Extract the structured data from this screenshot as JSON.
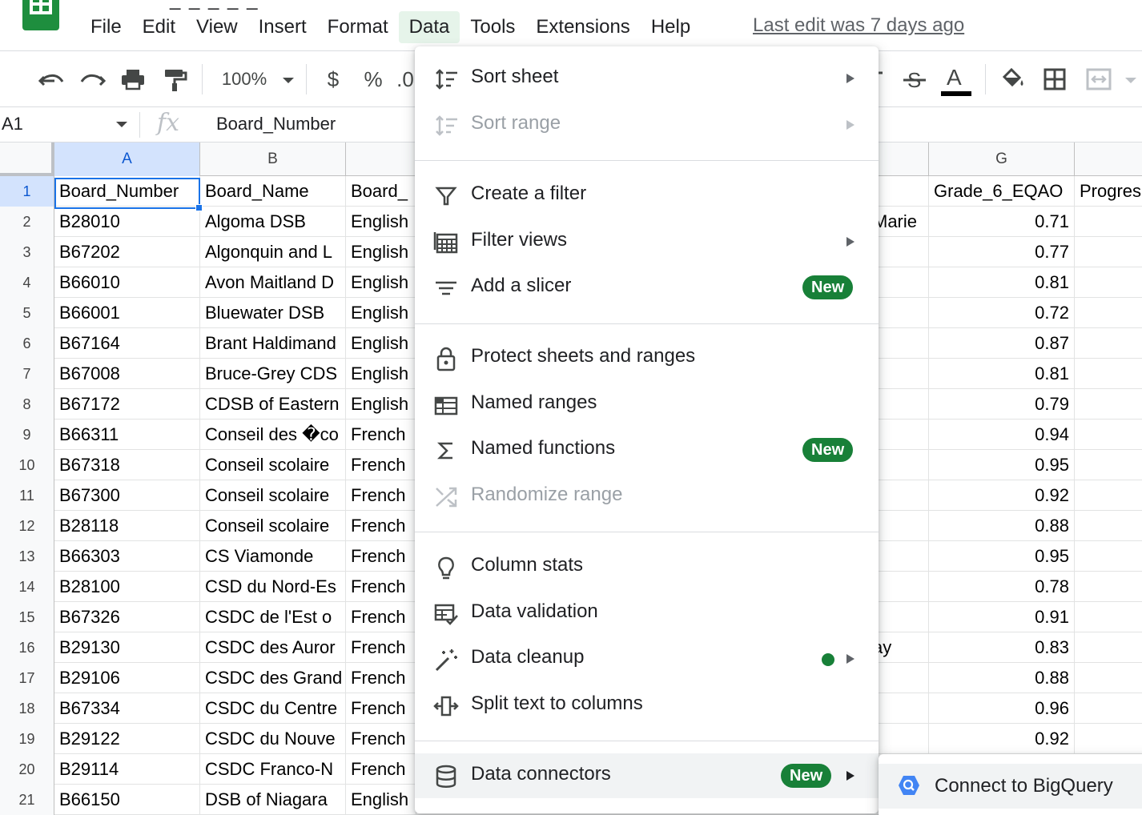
{
  "menubar": {
    "title_fragment": "_ _ _ _ _",
    "items": [
      "File",
      "Edit",
      "View",
      "Insert",
      "Format",
      "Data",
      "Tools",
      "Extensions",
      "Help"
    ],
    "last_edit": "Last edit was 7 days ago"
  },
  "toolbar": {
    "zoom": "100%",
    "currency": "$",
    "percent": "%",
    "decimal_fragment": ".0"
  },
  "formula_bar": {
    "cell_ref": "A1",
    "fx": "fx",
    "content": "Board_Number"
  },
  "columns": {
    "A": "A",
    "B": "B",
    "G": "G"
  },
  "rows": [
    {
      "num": "1",
      "a": "Board_Number",
      "b": "Board_Name",
      "c": "Board_",
      "f": "",
      "g": "Grade_6_EQAO",
      "h": "Progres"
    },
    {
      "num": "2",
      "a": "B28010",
      "b": "Algoma DSB",
      "c": "English",
      "f": "Marie",
      "g": "0.71",
      "h": ""
    },
    {
      "num": "3",
      "a": "B67202",
      "b": "Algonquin and L",
      "c": "English",
      "f": "",
      "g": "0.77",
      "h": ""
    },
    {
      "num": "4",
      "a": "B66010",
      "b": "Avon Maitland D",
      "c": "English",
      "f": "",
      "g": "0.81",
      "h": ""
    },
    {
      "num": "5",
      "a": "B66001",
      "b": "Bluewater DSB",
      "c": "English",
      "f": "",
      "g": "0.72",
      "h": ""
    },
    {
      "num": "6",
      "a": "B67164",
      "b": "Brant Haldimand",
      "c": "English",
      "f": "",
      "g": "0.87",
      "h": ""
    },
    {
      "num": "7",
      "a": "B67008",
      "b": "Bruce-Grey CDS",
      "c": "English",
      "f": "",
      "g": "0.81",
      "h": ""
    },
    {
      "num": "8",
      "a": "B67172",
      "b": "CDSB of Eastern",
      "c": "English",
      "f": "",
      "g": "0.79",
      "h": ""
    },
    {
      "num": "9",
      "a": "B66311",
      "b": "Conseil des �co",
      "c": "French",
      "f": "",
      "g": "0.94",
      "h": ""
    },
    {
      "num": "10",
      "a": "B67318",
      "b": "Conseil scolaire",
      "c": "French",
      "f": "",
      "g": "0.95",
      "h": ""
    },
    {
      "num": "11",
      "a": "B67300",
      "b": "Conseil scolaire",
      "c": "French",
      "f": "",
      "g": "0.92",
      "h": ""
    },
    {
      "num": "12",
      "a": "B28118",
      "b": "Conseil scolaire",
      "c": "French",
      "f": "",
      "g": "0.88",
      "h": ""
    },
    {
      "num": "13",
      "a": "B66303",
      "b": "CS Viamonde",
      "c": "French",
      "f": "",
      "g": "0.95",
      "h": ""
    },
    {
      "num": "14",
      "a": "B28100",
      "b": "CSD du Nord-Es",
      "c": "French",
      "f": "",
      "g": "0.78",
      "h": ""
    },
    {
      "num": "15",
      "a": "B67326",
      "b": "CSDC de l'Est o",
      "c": "French",
      "f": "",
      "g": "0.91",
      "h": ""
    },
    {
      "num": "16",
      "a": "B29130",
      "b": "CSDC des Auror",
      "c": "French",
      "f": "ay",
      "g": "0.83",
      "h": ""
    },
    {
      "num": "17",
      "a": "B29106",
      "b": "CSDC des Grand",
      "c": "French",
      "f": "",
      "g": "0.88",
      "h": ""
    },
    {
      "num": "18",
      "a": "B67334",
      "b": "CSDC du Centre",
      "c": "French",
      "f": "-",
      "g": "0.96",
      "h": ""
    },
    {
      "num": "19",
      "a": "B29122",
      "b": "CSDC du Nouve",
      "c": "French",
      "f": "",
      "g": "0.92",
      "h": ""
    },
    {
      "num": "20",
      "a": "B29114",
      "b": "CSDC Franco-N",
      "c": "French",
      "f": "",
      "g": "",
      "h": ""
    },
    {
      "num": "21",
      "a": "B66150",
      "b": "DSB of Niagara",
      "c": "English",
      "f": "",
      "g": "",
      "h": ""
    }
  ],
  "data_menu": {
    "sort_sheet": "Sort sheet",
    "sort_range": "Sort range",
    "create_filter": "Create a filter",
    "filter_views": "Filter views",
    "add_slicer": "Add a slicer",
    "protect": "Protect sheets and ranges",
    "named_ranges": "Named ranges",
    "named_functions": "Named functions",
    "randomize": "Randomize range",
    "column_stats": "Column stats",
    "data_validation": "Data validation",
    "data_cleanup": "Data cleanup",
    "split_text": "Split text to columns",
    "data_connectors": "Data connectors",
    "badge_new": "New"
  },
  "submenu": {
    "connect_bigquery": "Connect to BigQuery"
  },
  "colors": {
    "accent_green": "#188038",
    "selection_blue": "#1a73e8",
    "active_menu_bg": "#e6f4ea"
  }
}
